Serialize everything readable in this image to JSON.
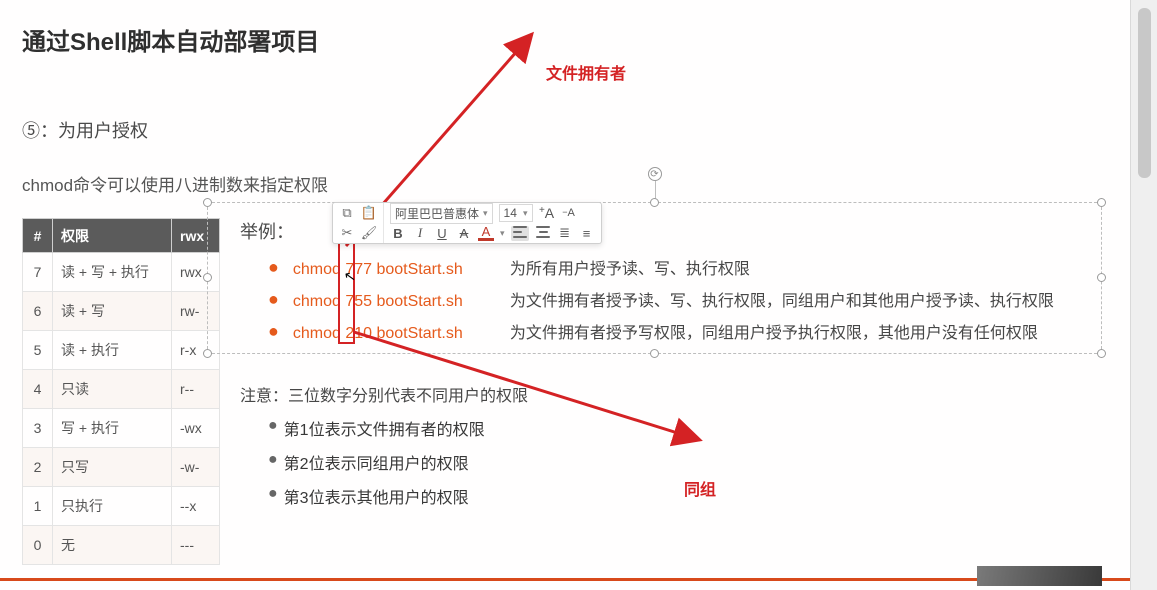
{
  "slide": {
    "title": "通过Shell脚本自动部署项目",
    "subtitle": "⑤：为用户授权",
    "desc": "chmod命令可以使用八进制数来指定权限"
  },
  "perm_table": {
    "headers": [
      "#",
      "权限",
      "rwx"
    ],
    "rows": [
      {
        "n": "7",
        "perm": "读 + 写 + 执行",
        "rwx": "rwx"
      },
      {
        "n": "6",
        "perm": "读 + 写",
        "rwx": "rw-"
      },
      {
        "n": "5",
        "perm": "读 + 执行",
        "rwx": "r-x"
      },
      {
        "n": "4",
        "perm": "只读",
        "rwx": "r--"
      },
      {
        "n": "3",
        "perm": "写 + 执行",
        "rwx": "-wx"
      },
      {
        "n": "2",
        "perm": "只写",
        "rwx": "-w-"
      },
      {
        "n": "1",
        "perm": "只执行",
        "rwx": "--x"
      },
      {
        "n": "0",
        "perm": "无",
        "rwx": "---"
      }
    ]
  },
  "examples": {
    "title": "举例：",
    "items": [
      {
        "cmd": "chmod 777 bootStart.sh",
        "exp": "为所有用户授予读、写、执行权限"
      },
      {
        "cmd": "chmod 755 bootStart.sh",
        "exp": "为文件拥有者授予读、写、执行权限，同组用户和其他用户授予读、执行权限"
      },
      {
        "cmd": "chmod 210 bootStart.sh",
        "exp": "为文件拥有者授予写权限，同组用户授予执行权限，其他用户没有任何权限"
      }
    ]
  },
  "note": {
    "title": "注意：三位数字分别代表不同用户的权限",
    "items": [
      "第1位表示文件拥有者的权限",
      "第2位表示同组用户的权限",
      "第3位表示其他用户的权限"
    ]
  },
  "annotations": {
    "owner": "文件拥有者",
    "group": "同组"
  },
  "toolbar": {
    "font": "阿里巴巴普惠体",
    "size": "14",
    "incA": "A",
    "decA": "A",
    "B": "B",
    "I": "I",
    "U": "U",
    "S": "A",
    "colorA": "A"
  }
}
